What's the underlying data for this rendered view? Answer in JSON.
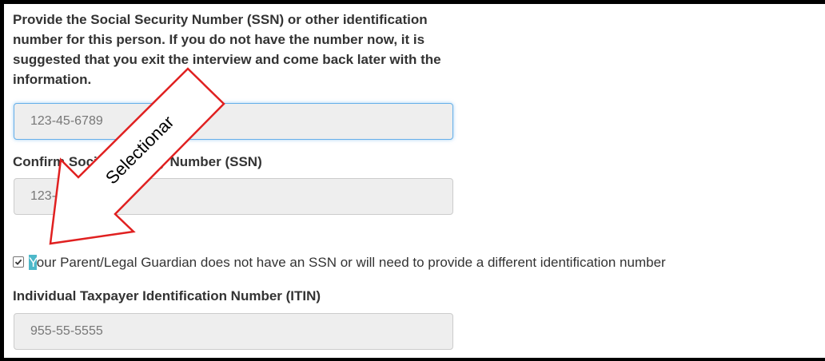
{
  "form": {
    "instructions": "Provide the Social Security Number (SSN) or other identification number for this person. If you do not have the number now, it is suggested that you exit the interview and come back later with the information.",
    "ssn_value": "123-45-6789",
    "confirm_ssn_label": "Confirm Social Security Number (SSN)",
    "confirm_ssn_value": "123-45-6789",
    "no_ssn_checkbox": {
      "checked": true,
      "label_first_letter": "Y",
      "label_rest": "our Parent/Legal Guardian does not have an SSN or will need to provide a different identification number"
    },
    "itin_label": "Individual Taxpayer Identification Number (ITIN)",
    "itin_value": "955-55-5555"
  },
  "annotation": {
    "text": "Selectionar",
    "arrow_color": "#e02020"
  }
}
